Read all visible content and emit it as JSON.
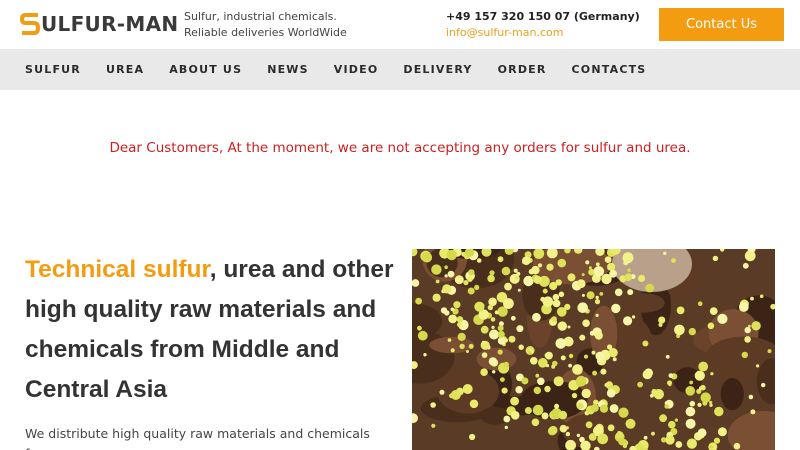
{
  "header": {
    "logo_text": "ULFUR-MAN",
    "tagline_line1": "Sulfur, industrial chemicals.",
    "tagline_line2": "Reliable deliveries WorldWide",
    "phone": "+49 157 320 150 07 (Germany)",
    "email": "info@sulfur-man.com",
    "contact_button": "Contact Us"
  },
  "nav": {
    "items": [
      "SULFUR",
      "UREA",
      "ABOUT US",
      "NEWS",
      "VIDEO",
      "DELIVERY",
      "ORDER",
      "CONTACTS"
    ]
  },
  "notice": "Dear Customers, At the moment, we are not accepting any orders for sulfur and urea.",
  "hero": {
    "title_accent": "Technical sulfur",
    "title_rest": ", urea and other high quality raw materials and chemicals from Middle and Central Asia",
    "description": "We distribute high quality raw materials and chemicals from",
    "image_icon": "sulfur-granules-photo"
  },
  "colors": {
    "accent": "#f39c12",
    "notice": "#cc1f1f",
    "nav_bg": "#e9e9e9",
    "text": "#333333"
  }
}
